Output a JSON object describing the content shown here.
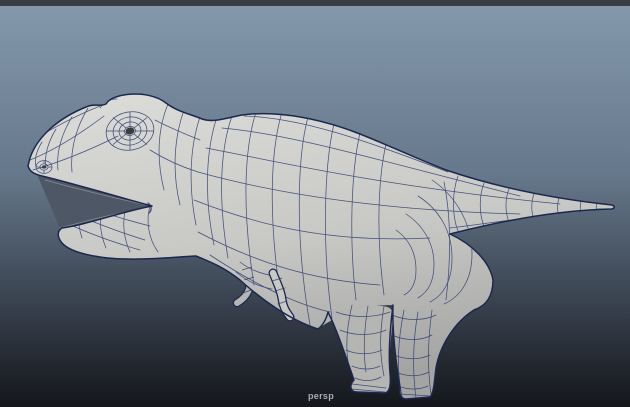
{
  "window": {
    "top_bar_color": "#3a3e43"
  },
  "viewport": {
    "camera_label": "persp",
    "camera_label_color": "#a9adb2",
    "background_top": "#8398ab",
    "background_mid": "#66788b",
    "background_low": "#333b47",
    "background_bottom": "#14161a",
    "model": {
      "name": "t-rex-polygon-wireframe-mesh",
      "surface_light": "#dcdcd9",
      "surface_mid": "#c8c8c5",
      "surface_dark": "#a4a5a3",
      "far_limb_shade": "#b5b5b2",
      "mouth_interior": "#4e5765",
      "mouth_inner_lip": "#9a9a97",
      "wireframe": "#2e3a70",
      "outline": "#1c2750",
      "pupil": "#383d42"
    }
  }
}
